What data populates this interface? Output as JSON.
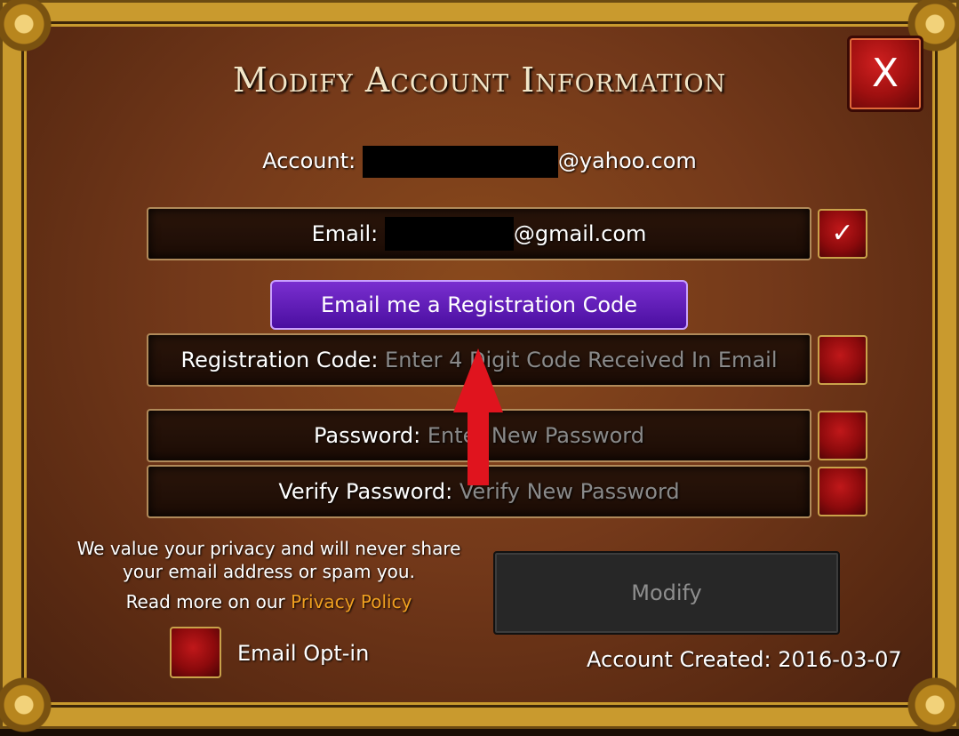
{
  "dialog": {
    "title": "Modify Account Information",
    "close_label": "X"
  },
  "account": {
    "label": "Account:",
    "domain": "@yahoo.com"
  },
  "email": {
    "label": "Email:",
    "domain": "@gmail.com",
    "verified_mark": "✓"
  },
  "register_button_label": "Email me a Registration Code",
  "registration": {
    "label": "Registration Code:",
    "placeholder": "Enter 4 Digit Code Received In Email"
  },
  "password": {
    "label": "Password:",
    "placeholder": "Enter New Password"
  },
  "verify_password": {
    "label": "Verify Password:",
    "placeholder": "Verify New Password"
  },
  "privacy": {
    "line1": "We value your privacy and will never share",
    "line2": "your email address or spam you.",
    "read_more": "Read more on our",
    "link_text": "Privacy Policy"
  },
  "modify_button_label": "Modify",
  "email_optin_label": "Email Opt-in",
  "account_created": "Account Created: 2016-03-07",
  "colors": {
    "frame_gold": "#c99a2e",
    "panel_brown": "#74391a",
    "checkbox_red": "#a01010",
    "register_button_purple": "#5a18b0",
    "link_orange": "#f0a020",
    "arrow_red": "#e0141e"
  }
}
